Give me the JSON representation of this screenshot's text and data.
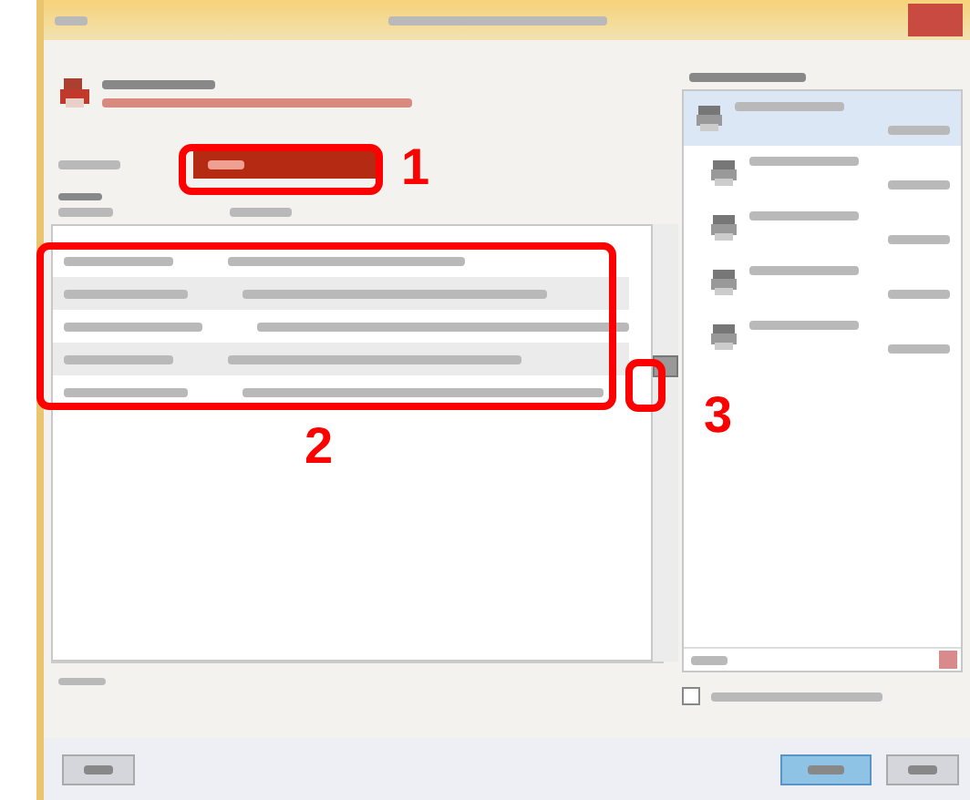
{
  "callouts": [
    {
      "label": "1"
    },
    {
      "label": "2"
    },
    {
      "label": "3"
    }
  ],
  "table": {
    "rows": [
      {
        "shaded": false
      },
      {
        "shaded": true
      },
      {
        "shaded": false
      },
      {
        "shaded": true
      },
      {
        "shaded": false
      }
    ]
  },
  "printers": [
    {
      "selected": true
    },
    {
      "selected": false
    },
    {
      "selected": false
    },
    {
      "selected": false
    },
    {
      "selected": false
    }
  ],
  "option_checkbox": {
    "checked": false
  }
}
